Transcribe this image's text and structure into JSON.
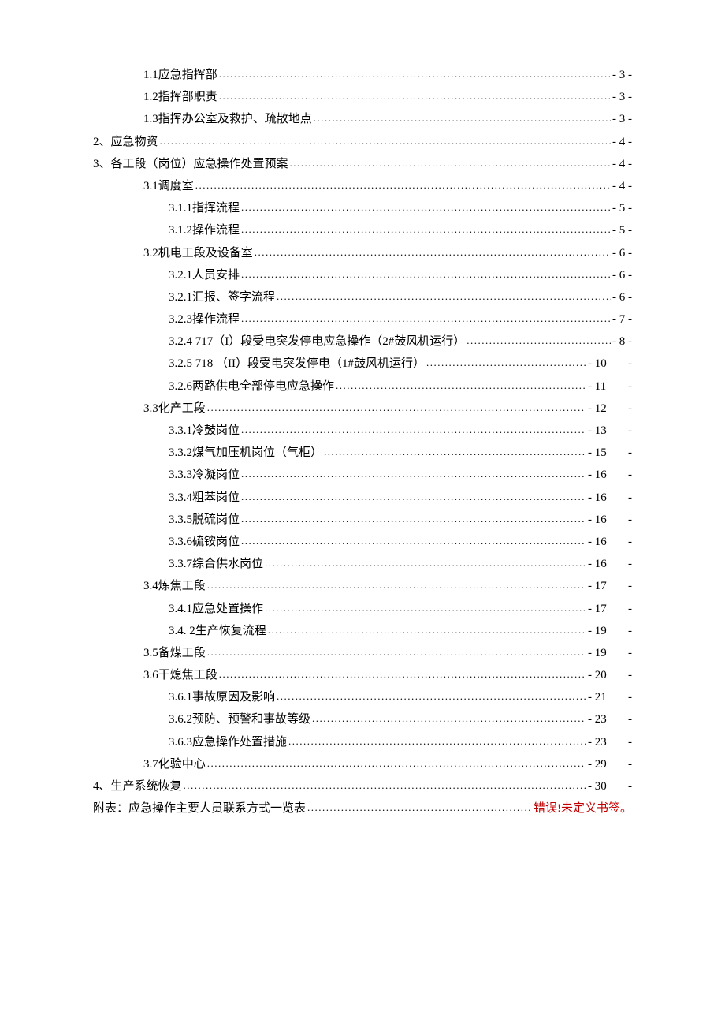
{
  "toc": [
    {
      "level": 1,
      "title": "1.1应急指挥部",
      "page": "- 3 -",
      "wide": false
    },
    {
      "level": 1,
      "title": "1.2指挥部职责",
      "page": "- 3 -",
      "wide": false
    },
    {
      "level": 1,
      "title": "1.3指挥办公室及救护、疏散地点",
      "page": "- 3 -",
      "wide": false
    },
    {
      "level": 0,
      "title": "2、应急物资",
      "page": "- 4 -",
      "wide": false
    },
    {
      "level": 0,
      "title": "3、各工段（岗位）应急操作处置预案",
      "page": "- 4 -",
      "wide": false
    },
    {
      "level": 1,
      "title": "3.1调度室",
      "page": "- 4 -",
      "wide": false
    },
    {
      "level": 2,
      "title": "3.1.1指挥流程",
      "page": " - 5 -",
      "wide": false
    },
    {
      "level": 2,
      "title": "3.1.2操作流程",
      "page": "- 5 -",
      "wide": false
    },
    {
      "level": 1,
      "title": "3.2机电工段及设备室",
      "page": "- 6 -",
      "wide": false
    },
    {
      "level": 2,
      "title": "3.2.1人员安排",
      "page": "- 6 -",
      "wide": false
    },
    {
      "level": 2,
      "title": "3.2.1汇报、签字流程",
      "page": "- 6 -",
      "wide": false
    },
    {
      "level": 2,
      "title": "3.2.3操作流程",
      "page": "- 7 -",
      "wide": false
    },
    {
      "level": 2,
      "title": "3.2.4 717（I）段受电突发停电应急操作（2#鼓风机运行）",
      "page": "- 8 -",
      "wide": false
    },
    {
      "level": 2,
      "title": "3.2.5 718 （II）段受电突发停电（1#鼓风机运行）",
      "page": "- 10",
      "wide": true
    },
    {
      "level": 2,
      "title": "3.2.6两路供电全部停电应急操作",
      "page": "- 11",
      "wide": true
    },
    {
      "level": 1,
      "title": "3.3化产工段",
      "page": "- 12",
      "wide": true
    },
    {
      "level": 2,
      "title": "3.3.1冷鼓岗位",
      "page": "- 13",
      "wide": true
    },
    {
      "level": 2,
      "title": "3.3.2煤气加压机岗位（气柜）",
      "page": " - 15",
      "wide": true
    },
    {
      "level": 2,
      "title": "3.3.3冷凝岗位",
      "page": "- 16",
      "wide": true
    },
    {
      "level": 2,
      "title": "3.3.4粗苯岗位",
      "page": "- 16",
      "wide": true
    },
    {
      "level": 2,
      "title": "3.3.5脱硫岗位",
      "page": "- 16",
      "wide": true
    },
    {
      "level": 2,
      "title": "3.3.6硫铵岗位",
      "page": "- 16",
      "wide": true
    },
    {
      "level": 2,
      "title": "3.3.7综合供水岗位",
      "page": "- 16",
      "wide": true
    },
    {
      "level": 1,
      "title": "3.4炼焦工段",
      "page": "- 17",
      "wide": true
    },
    {
      "level": 2,
      "title": "3.4.1应急处置操作",
      "page": "- 17",
      "wide": true
    },
    {
      "level": 2,
      "title": "3.4. 2生产恢复流程",
      "page": "- 19",
      "wide": true
    },
    {
      "level": 1,
      "title": "3.5备煤工段",
      "page": "- 19",
      "wide": true
    },
    {
      "level": 1,
      "title": "3.6干熄焦工段",
      "page": "- 20",
      "wide": true
    },
    {
      "level": 2,
      "title": "3.6.1事故原因及影响",
      "page": "- 21",
      "wide": true
    },
    {
      "level": 2,
      "title": "3.6.2预防、预警和事故等级",
      "page": "- 23",
      "wide": true
    },
    {
      "level": 2,
      "title": "3.6.3应急操作处置措施",
      "page": "- 23",
      "wide": true
    },
    {
      "level": 1,
      "title": "3.7化验中心",
      "page": "- 29",
      "wide": true
    },
    {
      "level": 0,
      "title": "4、生产系统恢复",
      "page": "- 30",
      "wide": true
    },
    {
      "level": 0,
      "title": "附表：应急操作主要人员联系方式一览表",
      "page": "错误!未定义书签。",
      "wide": false,
      "red": true,
      "noLeaderSplit": false
    }
  ]
}
